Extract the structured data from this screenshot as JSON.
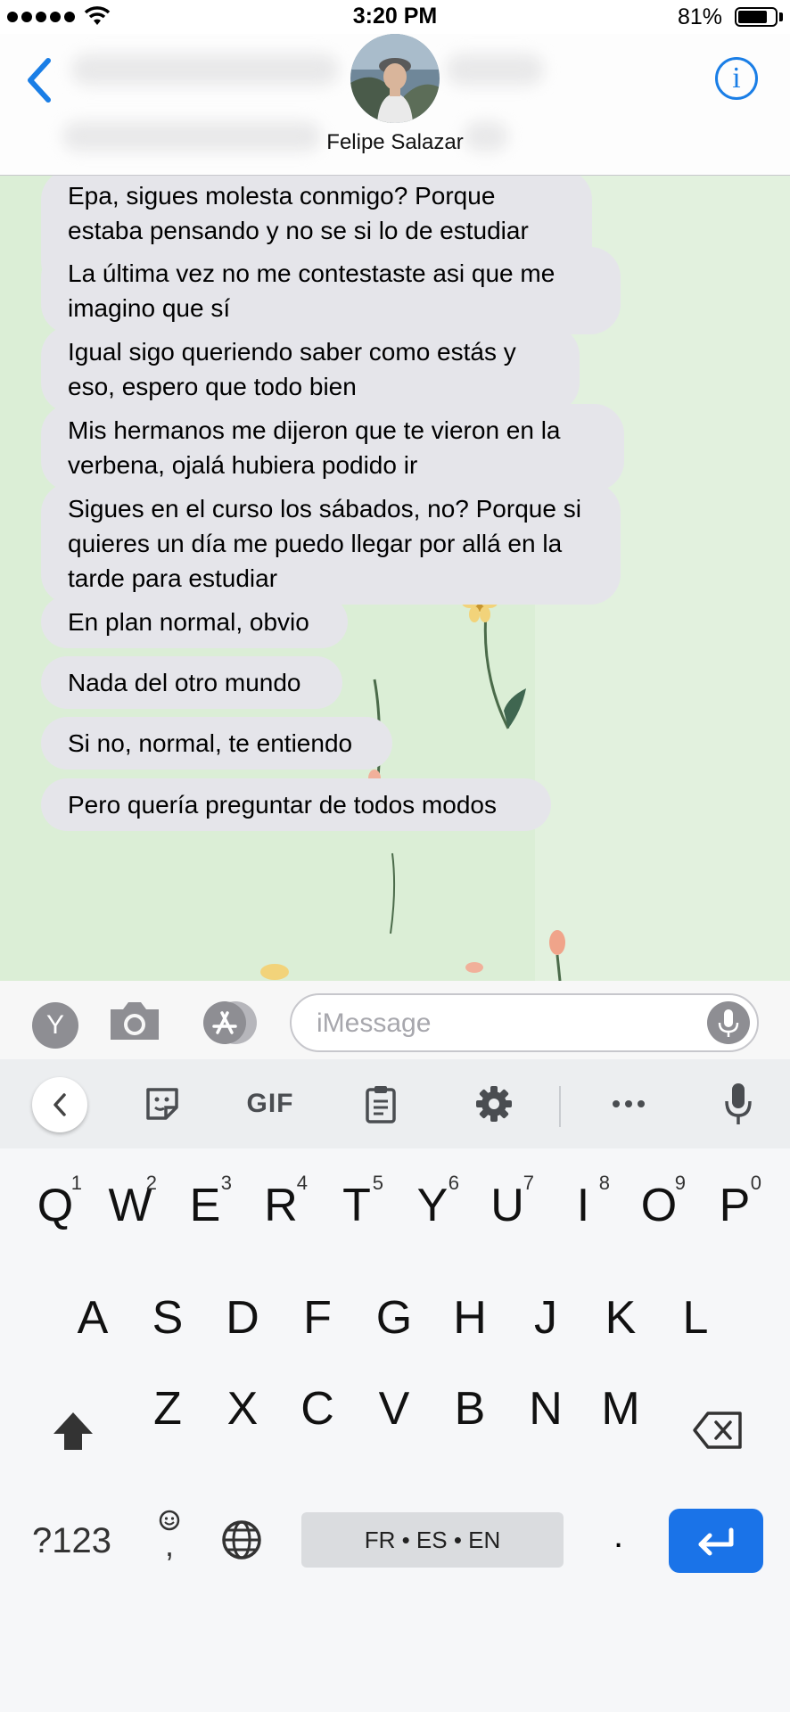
{
  "status_bar": {
    "time": "3:20 PM",
    "battery": "81%",
    "battery_level": 0.81
  },
  "header": {
    "contact_name": "Felipe Salazar",
    "info_icon": "info-icon",
    "back_icon": "chevron-left-icon"
  },
  "messages": [
    "Epa, sigues molesta conmigo? Porque estaba pensando y no se si lo de estudiar sigue en pie",
    "La última vez no me contestaste asi que me imagino que sí",
    "Igual sigo queriendo saber como estás y eso, espero que todo bien",
    "Mis hermanos me dijeron que te vieron en la verbena, ojalá hubiera podido ir",
    "Sigues en el curso los sábados, no? Porque si quieres un día me puedo llegar por allá en la tarde para estudiar",
    "En plan normal, obvio",
    "Nada del otro mundo",
    "Si no, normal, te entiendo",
    "Pero quería preguntar de todos modos"
  ],
  "input_bar": {
    "app_circle_label": "Y",
    "placeholder": "iMessage"
  },
  "keyboard_toolbar": {
    "gif_label": "GIF"
  },
  "keyboard": {
    "row1": [
      "Q",
      "W",
      "E",
      "R",
      "T",
      "Y",
      "U",
      "I",
      "O",
      "P"
    ],
    "row1_hints": [
      "1",
      "2",
      "3",
      "4",
      "5",
      "6",
      "7",
      "8",
      "9",
      "0"
    ],
    "row2": [
      "A",
      "S",
      "D",
      "F",
      "G",
      "H",
      "J",
      "K",
      "L"
    ],
    "row3": [
      "Z",
      "X",
      "C",
      "V",
      "B",
      "N",
      "M"
    ],
    "symbols_key": "?123",
    "comma_key": ",",
    "space_label": "FR • ES • EN",
    "period_key": "."
  },
  "colors": {
    "accent": "#1a7ee6",
    "bubble": "#e5e5ea",
    "enter_key": "#1a73e8"
  }
}
